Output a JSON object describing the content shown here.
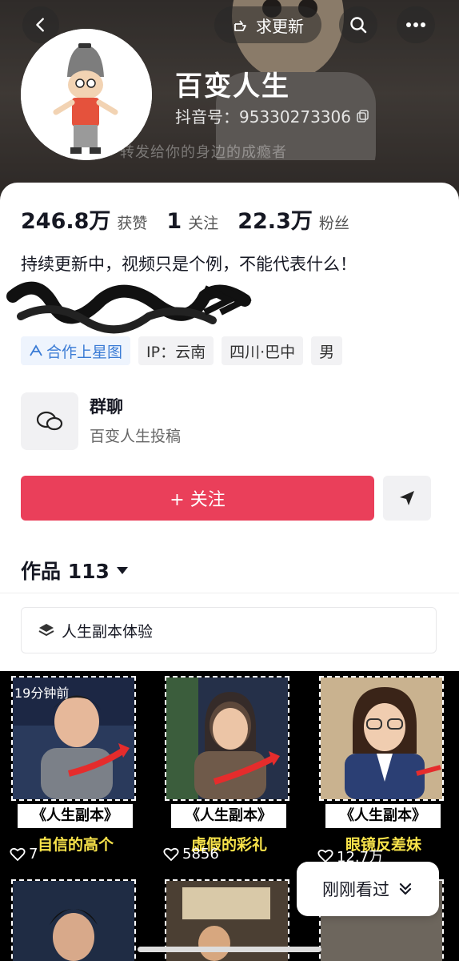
{
  "header": {
    "update_label": "求更新",
    "caption": "转发给你的身边的成瘾者"
  },
  "profile": {
    "nickname": "百变人生",
    "douyin_id": "抖音号：95330273306"
  },
  "stats": {
    "likes_value": "246.8万",
    "likes_label": "获赞",
    "following_value": "1",
    "following_label": "关注",
    "fans_value": "22.3万",
    "fans_label": "粉丝"
  },
  "bio": "持续更新中，视频只是个例，不能代表什么！",
  "tags": [
    "合作上星图",
    "IP：云南",
    "四川·巴中",
    "男"
  ],
  "group_chat": {
    "title": "群聊",
    "subtitle": "百变人生投稿"
  },
  "actions": {
    "follow_label": "+ 关注"
  },
  "works": {
    "label": "作品 113"
  },
  "collection": {
    "label": "人生副本体验"
  },
  "videos": [
    {
      "time": "19分钟前",
      "banner": "《人生副本》",
      "subtitle": "自信的高个",
      "likes": "7"
    },
    {
      "time": "",
      "banner": "《人生副本》",
      "subtitle": "虚假的彩礼",
      "likes": "5856"
    },
    {
      "time": "",
      "banner": "《人生副本》",
      "subtitle": "眼镜反差妹",
      "likes": "12.7万"
    }
  ],
  "recent_button": "刚刚看过",
  "colors": {
    "follow": "#ea3f5a",
    "subtitle_yellow": "#f7e24a",
    "star_tag": "#3a7bd5"
  }
}
